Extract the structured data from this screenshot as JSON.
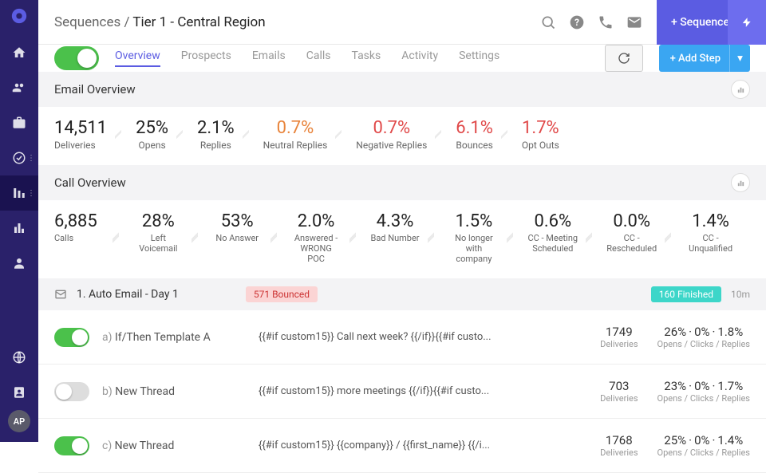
{
  "breadcrumb": {
    "parent": "Sequences",
    "current": "Tier 1 - Central Region"
  },
  "topbar": {
    "add_sequence": "+ Sequence"
  },
  "tabs": [
    "Overview",
    "Prospects",
    "Emails",
    "Calls",
    "Tasks",
    "Activity",
    "Settings"
  ],
  "active_tab": "Overview",
  "add_step_label": "+ Add Step",
  "email_overview": {
    "title": "Email Overview",
    "stats": [
      {
        "value": "14,511",
        "label": "Deliveries",
        "tone": ""
      },
      {
        "value": "25%",
        "label": "Opens",
        "tone": ""
      },
      {
        "value": "2.1%",
        "label": "Replies",
        "tone": ""
      },
      {
        "value": "0.7%",
        "label": "Neutral Replies",
        "tone": "warn"
      },
      {
        "value": "0.7%",
        "label": "Negative Replies",
        "tone": "danger"
      },
      {
        "value": "6.1%",
        "label": "Bounces",
        "tone": "danger"
      },
      {
        "value": "1.7%",
        "label": "Opt Outs",
        "tone": "danger"
      }
    ]
  },
  "call_overview": {
    "title": "Call Overview",
    "stats": [
      {
        "value": "6,885",
        "label": "Calls"
      },
      {
        "value": "28%",
        "label": "Left Voicemail"
      },
      {
        "value": "53%",
        "label": "No Answer"
      },
      {
        "value": "2.0%",
        "label": "Answered - WRONG POC"
      },
      {
        "value": "4.3%",
        "label": "Bad Number"
      },
      {
        "value": "1.5%",
        "label": "No longer with company"
      },
      {
        "value": "0.6%",
        "label": "CC - Meeting Scheduled"
      },
      {
        "value": "0.0%",
        "label": "CC - Rescheduled"
      },
      {
        "value": "1.4%",
        "label": "CC - Unqualified"
      }
    ]
  },
  "step": {
    "title": "1. Auto Email - Day 1",
    "bounced": "571 Bounced",
    "finished": "160 Finished",
    "time": "10m"
  },
  "variants": [
    {
      "on": true,
      "letter": "a)",
      "name": "If/Then Template A",
      "preview": "{{#if custom15}} Call next week? {{/if}}{{#if custo...",
      "deliveries": "1749",
      "opens": "26%",
      "clicks": "0%",
      "replies": "1.8%"
    },
    {
      "on": false,
      "letter": "b)",
      "name": "New Thread",
      "preview": "{{#if custom15}} more meetings {{/if}}{{#if custo...",
      "deliveries": "703",
      "opens": "23%",
      "clicks": "0%",
      "replies": "1.7%"
    },
    {
      "on": true,
      "letter": "c)",
      "name": "New Thread",
      "preview": "{{#if custom15}} {{company}} / {{first_name}} {{/i...",
      "deliveries": "1768",
      "opens": "25%",
      "clicks": "0%",
      "replies": "1.4%"
    }
  ],
  "labels": {
    "deliveries": "Deliveries",
    "ocr": "Opens / Clicks / Replies"
  },
  "avatar": "AP"
}
